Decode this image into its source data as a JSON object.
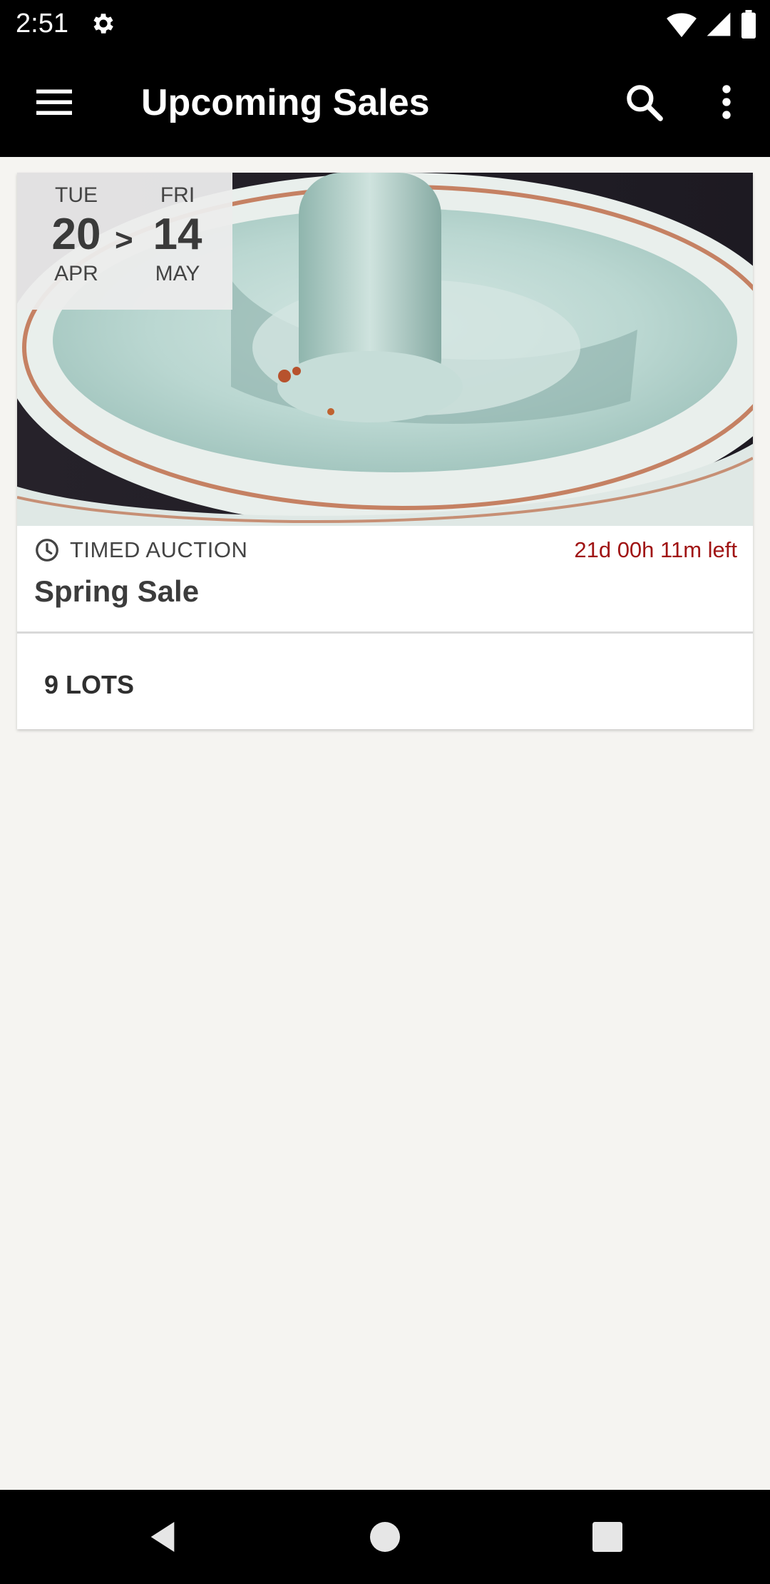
{
  "status_bar": {
    "time": "2:51",
    "icons": [
      "gear-icon",
      "wifi-icon",
      "signal-icon",
      "battery-icon"
    ]
  },
  "app_bar": {
    "title": "Upcoming Sales",
    "menu_icon": "menu-icon",
    "search_icon": "search-icon",
    "more_icon": "more-vert-icon"
  },
  "sale": {
    "image": "ceramic-dish-photo",
    "start": {
      "dow": "TUE",
      "day": "20",
      "month": "APR"
    },
    "separator": ">",
    "end": {
      "dow": "FRI",
      "day": "14",
      "month": "MAY"
    },
    "type_icon": "clock-icon",
    "type": "TIMED AUCTION",
    "time_left": "21d 00h 11m left",
    "title": "Spring Sale",
    "lots": "9 LOTS"
  },
  "colors": {
    "app_bar_bg": "#000000",
    "page_bg": "#f5f4f1",
    "time_left": "#a01414"
  },
  "nav_bar": {
    "buttons": [
      "back-icon",
      "home-icon",
      "recents-icon"
    ]
  }
}
